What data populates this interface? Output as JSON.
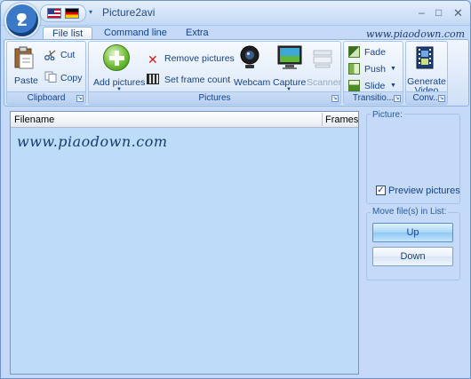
{
  "window": {
    "title": "Picture2avi",
    "orb_label": "2",
    "controls": {
      "minimize": "–",
      "maximize": "□",
      "close": "✕"
    },
    "qat_dropdown": "▾"
  },
  "tabs": [
    {
      "label": "File list",
      "active": true
    },
    {
      "label": "Command line",
      "active": false
    },
    {
      "label": "Extra",
      "active": false
    }
  ],
  "watermark": "www.piaodown.com",
  "ribbon": {
    "clipboard": {
      "label": "Clipboard",
      "paste": "Paste",
      "cut": "Cut",
      "copy": "Copy"
    },
    "pictures": {
      "label": "Pictures",
      "add": "Add pictures",
      "remove": "Remove pictures",
      "set_frame_count": "Set frame count",
      "webcam": "Webcam",
      "capture": "Capture",
      "scanner": "Scanner"
    },
    "transitions": {
      "label": "Transitio...",
      "fade": "Fade",
      "push": "Push",
      "slide": "Slide"
    },
    "convert": {
      "label": "Conv...",
      "generate": "Generate Video"
    }
  },
  "filelist": {
    "columns": [
      "Filename",
      "Frames"
    ]
  },
  "side": {
    "picture_label": "Picture:",
    "preview_label": "Preview pictures",
    "preview_checked": true,
    "move_label": "Move file(s) in List:",
    "up": "Up",
    "down": "Down"
  },
  "colors": {
    "list_bg": "#bcdcfa",
    "ribbon_text": "#15428b"
  }
}
